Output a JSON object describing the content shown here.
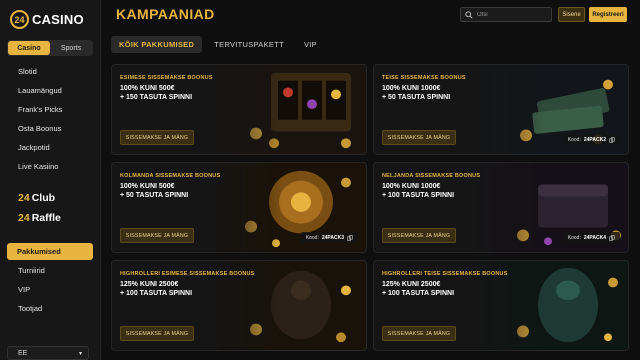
{
  "brand": {
    "badge": "24",
    "name": "CASINO",
    "accent": "#e7b53f"
  },
  "segment": {
    "casino": "Casino",
    "sports": "Sports"
  },
  "sidebar": {
    "items": [
      "Slotid",
      "Lauamängud",
      "Frank's Picks",
      "Osta Boonus",
      "Jackpotid",
      "Live Kasiino"
    ],
    "club": {
      "num": "24",
      "label": "Club"
    },
    "raffle": {
      "num": "24",
      "label": "Raffle"
    },
    "active": "Pakkumised",
    "items2": [
      "Turniirid",
      "VIP",
      "Tootjad"
    ],
    "language": "EE"
  },
  "header": {
    "title": "KAMPAANIAD",
    "search_placeholder": "Otsi",
    "login": "Sisene",
    "register": "Registreeri"
  },
  "tabs": [
    "KÕIK PAKKUMISED",
    "TERVITUSPAKETT",
    "VIP"
  ],
  "cards": [
    {
      "label": "ESIMESE SISSEMAKSE BOONUS",
      "line1": "100% KUNI 500€",
      "line2": "+ 150 TASUTA SPINNI",
      "cta": "SISSEMAKSE JA MÄNG",
      "code_label": "",
      "code": ""
    },
    {
      "label": "TEISE SISSEMAKSE BOONUS",
      "line1": "100% KUNI 1000€",
      "line2": "+ 50 TASUTA SPINNI",
      "cta": "SISSEMAKSE JA MÄNG",
      "code_label": "Kood:",
      "code": "24PACK2"
    },
    {
      "label": "KOLMANDA SISSEMAKSE BOONUS",
      "line1": "100% KUNI 500€",
      "line2": "+ 50 TASUTA SPINNI",
      "cta": "SISSEMAKSE JA MÄNG",
      "code_label": "Kood:",
      "code": "24PACK3"
    },
    {
      "label": "NELJANDA SISSEMAKSE BOONUS",
      "line1": "100% KUNI 1000€",
      "line2": "+ 100 TASUTA SPINNI",
      "cta": "SISSEMAKSE JA MÄNG",
      "code_label": "Kood:",
      "code": "24PACK4"
    },
    {
      "label": "HIGHROLLERI ESIMESE SISSEMAKSE BOONUS",
      "line1": "125% KUNI 2500€",
      "line2": "+ 100 TASUTA SPINNI",
      "cta": "SISSEMAKSE JA MÄNG",
      "code_label": "",
      "code": ""
    },
    {
      "label": "HIGHROLLERI TEISE SISSEMAKSE BOONUS",
      "line1": "125% KUNI 2500€",
      "line2": "+ 100 TASUTA SPINNI",
      "cta": "SISSEMAKSE JA MÄNG",
      "code_label": "",
      "code": ""
    }
  ]
}
